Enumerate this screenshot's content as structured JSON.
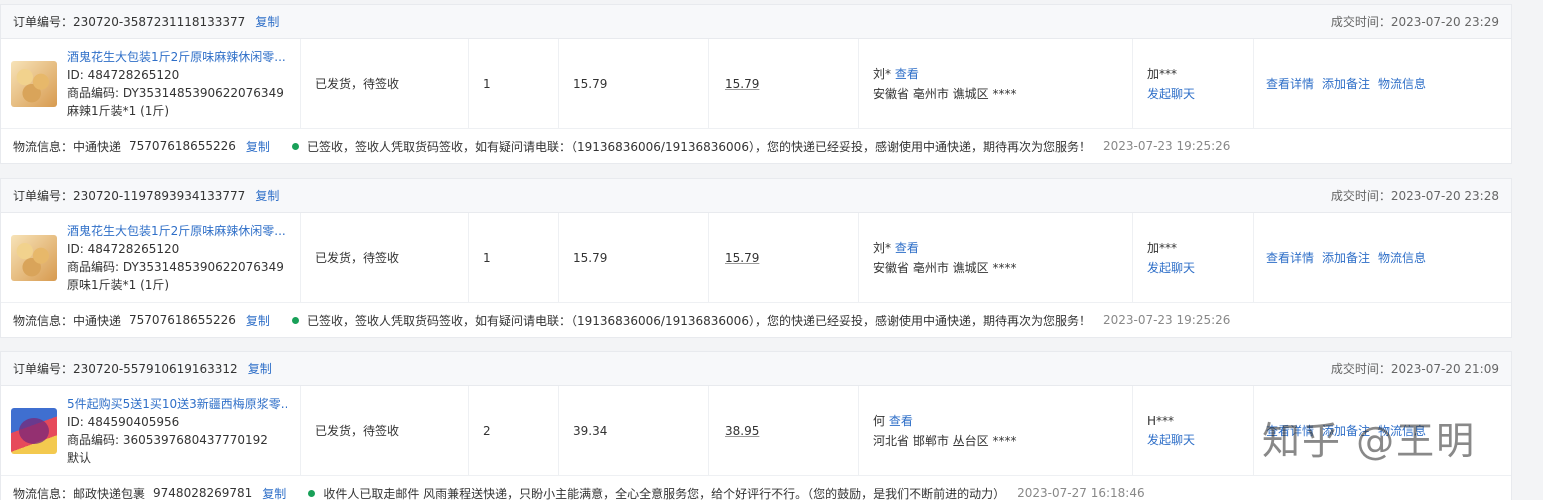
{
  "labels": {
    "order_no": "订单编号：",
    "copy": "复制",
    "deal_time": "成交时间：",
    "view": "查看",
    "start_chat": "发起聊天",
    "logistics": "物流信息：",
    "actions": [
      "查看详情",
      "添加备注",
      "物流信息"
    ]
  },
  "orders": [
    {
      "order_no": "230720-3587231118133377",
      "deal_time": "2023-07-20 23:29",
      "product_title": "酒鬼花生大包装1斤2斤原味麻辣休闲零...",
      "product_id": "ID: 484728265120",
      "product_code": "商品编码: DY3531485390622076349",
      "sku": "麻辣1斤装*1 (1斤)",
      "status": "已发货，待签收",
      "qty": "1",
      "price": "15.79",
      "paid": "15.79",
      "buyer": "刘*",
      "address": "安徽省 亳州市 谯城区 ****",
      "contact": "加***",
      "logistics_company": "中通快递",
      "tracking_no": "75707618655226",
      "logistics_msg": "已签收，签收人凭取货码签收，如有疑问请电联：（19136836006/19136836006），您的快递已经妥投，感谢使用中通快递，期待再次为您服务！",
      "logistics_time": "2023-07-23 19:25:26"
    },
    {
      "order_no": "230720-1197893934133777",
      "deal_time": "2023-07-20 23:28",
      "product_title": "酒鬼花生大包装1斤2斤原味麻辣休闲零...",
      "product_id": "ID: 484728265120",
      "product_code": "商品编码: DY3531485390622076349",
      "sku": "原味1斤装*1 (1斤)",
      "status": "已发货，待签收",
      "qty": "1",
      "price": "15.79",
      "paid": "15.79",
      "buyer": "刘*",
      "address": "安徽省 亳州市 谯城区 ****",
      "contact": "加***",
      "logistics_company": "中通快递",
      "tracking_no": "75707618655226",
      "logistics_msg": "已签收，签收人凭取货码签收，如有疑问请电联：（19136836006/19136836006），您的快递已经妥投，感谢使用中通快递，期待再次为您服务！",
      "logistics_time": "2023-07-23 19:25:26"
    },
    {
      "order_no": "230720-557910619163312",
      "deal_time": "2023-07-20 21:09",
      "product_title": "5件起购买5送1买10送3新疆西梅原浆零...",
      "product_id": "ID: 484590405956",
      "product_code": "商品编码: 3605397680437770192",
      "sku": "默认",
      "status": "已发货，待签收",
      "qty": "2",
      "price": "39.34",
      "paid": "38.95",
      "buyer": "何",
      "address": "河北省 邯郸市 丛台区 ****",
      "contact": "H***",
      "logistics_company": "邮政快递包裹",
      "tracking_no": "9748028269781",
      "logistics_msg": "收件人已取走邮件 风雨兼程送快递，只盼小主能满意，全心全意服务您，给个好评行不行。（您的鼓励，是我们不断前进的动力）",
      "logistics_time": "2023-07-27 16:18:46"
    }
  ],
  "watermark": "知乎 @王明"
}
